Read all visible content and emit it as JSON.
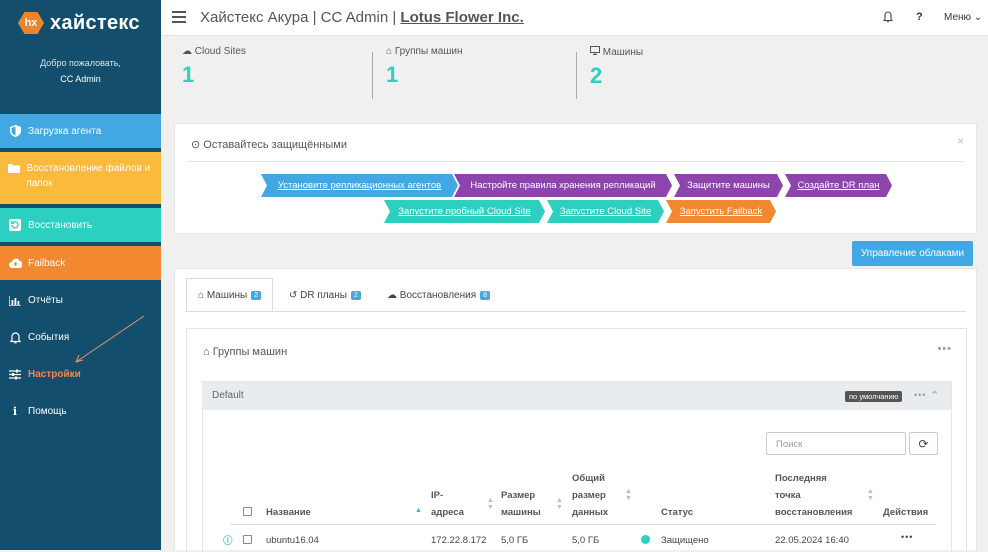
{
  "brand": {
    "badge": "hx",
    "name": "хайстекс"
  },
  "sidebar": {
    "welcome": "Добро пожаловать,",
    "user": "CC Admin",
    "items": [
      {
        "label": "Загрузка агента",
        "icon": "shield-icon"
      },
      {
        "label": "Восстановление файлов и папок",
        "icon": "folder-icon"
      },
      {
        "label": "Восстановить",
        "icon": "restore-icon"
      },
      {
        "label": "Failback",
        "icon": "cloud-upload-icon"
      },
      {
        "label": "Отчёты",
        "icon": "bar-chart-icon"
      },
      {
        "label": "События",
        "icon": "bell-icon"
      },
      {
        "label": "Настройки",
        "icon": "sliders-icon"
      },
      {
        "label": "Помощь",
        "icon": "info-icon"
      }
    ]
  },
  "topbar": {
    "title_prefix": "Хайстекс Акура | CC Admin | ",
    "company": "Lotus Flower Inc.",
    "help": "?",
    "menu": "Меню"
  },
  "stats": [
    {
      "label": "Cloud Sites",
      "value": "1",
      "icon": "cloud-icon"
    },
    {
      "label": "Группы машин",
      "value": "1",
      "icon": "home-icon"
    },
    {
      "label": "Машины",
      "value": "2",
      "icon": "monitor-icon"
    }
  ],
  "protect": {
    "title": "Оставайтесь защищёнными",
    "close": "×",
    "steps": [
      "Установите репликационных агентов",
      "Настройте правила хранения репликаций",
      "Защитите машины",
      "Создайте DR план",
      "Запустите пробный Cloud Site",
      "Запустите Cloud Site",
      "Запустить Failback"
    ]
  },
  "clouds_button": "Управление облаками",
  "tabs": [
    {
      "label": "Машины",
      "count": "2"
    },
    {
      "label": "DR планы",
      "count": "2"
    },
    {
      "label": "Восстановления",
      "count": "8"
    }
  ],
  "groups": {
    "title": "Группы машин",
    "group_name": "Default",
    "default_badge": "по умолчанию",
    "search_placeholder": "Поиск",
    "columns": {
      "name": "Название",
      "ip": [
        "IP-",
        "адреса"
      ],
      "size": [
        "Размер",
        "машины"
      ],
      "total": [
        "Общий",
        "размер",
        "данных"
      ],
      "status": "Статус",
      "restore": [
        "Последняя",
        "точка",
        "восстановления"
      ],
      "actions": "Действия"
    },
    "rows": [
      {
        "name": "ubuntu16.04",
        "ip": "172.22.8.172",
        "size": "5,0 ГБ",
        "total": "5,0 ГБ",
        "status": "Защищено",
        "restore": "22.05.2024 16:40",
        "status_color": "#2ccfc0"
      }
    ]
  },
  "colors": {
    "sidebar": "#134f6c",
    "blue": "#41a8e4",
    "yellow": "#fbba3c",
    "teal": "#2ccfc0",
    "orange": "#f2882f",
    "purple": "#8e44ad"
  }
}
